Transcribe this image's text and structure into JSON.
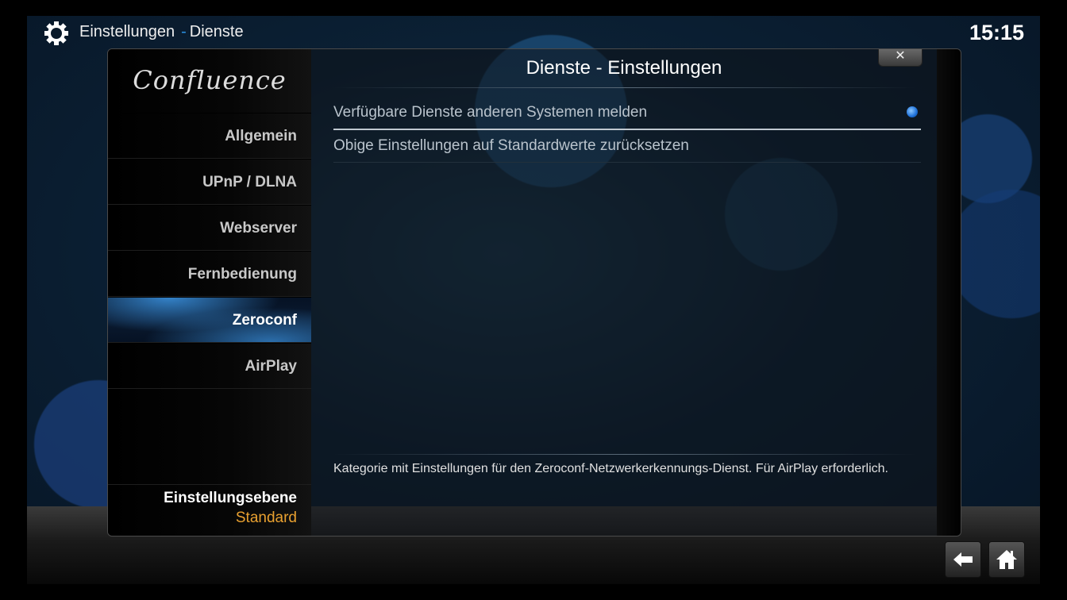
{
  "header": {
    "section": "Einstellungen",
    "separator": "-",
    "subsection": "Dienste",
    "clock": "15:15",
    "icon": "gear-icon"
  },
  "dialog": {
    "title": "Dienste - Einstellungen",
    "close_label": "✕",
    "logo": "Confluence"
  },
  "sidebar": {
    "items": [
      {
        "label": "Allgemein"
      },
      {
        "label": "UPnP / DLNA"
      },
      {
        "label": "Webserver"
      },
      {
        "label": "Fernbedienung"
      },
      {
        "label": "Zeroconf",
        "active": true
      },
      {
        "label": "AirPlay"
      }
    ],
    "level_label": "Einstellungsebene",
    "level_value": "Standard"
  },
  "settings": [
    {
      "label": "Verfügbare Dienste anderen Systemen melden",
      "enabled": true
    },
    {
      "label": "Obige Einstellungen auf Standardwerte zurücksetzen"
    }
  ],
  "description": "Kategorie mit Einstellungen für den Zeroconf-Netzwerkerkennungs-Dienst. Für AirPlay erforderlich.",
  "footer": {
    "back_icon": "back-arrow-icon",
    "home_icon": "home-icon"
  },
  "colors": {
    "accent": "#2a8fe0",
    "level_value": "#e8a030"
  }
}
